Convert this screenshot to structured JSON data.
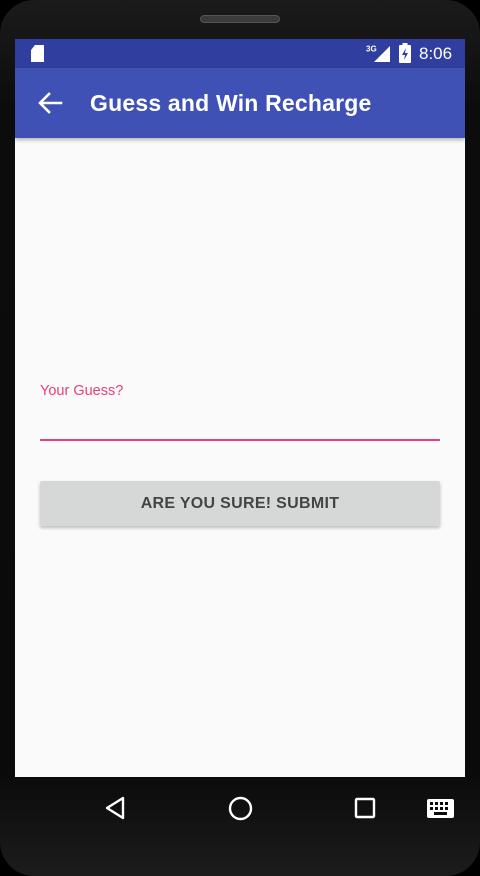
{
  "status_bar": {
    "network_type": "3G",
    "time": "8:06",
    "icons": [
      "sd-card-icon",
      "signal-icon",
      "battery-charging-icon"
    ]
  },
  "app_bar": {
    "title": "Guess and Win Recharge",
    "back_icon": "arrow-left-icon"
  },
  "form": {
    "guess_label": "Your Guess?",
    "guess_value": "",
    "submit_label": "ARE YOU SURE! SUBMIT"
  },
  "nav_bar": {
    "icons": [
      "nav-back-icon",
      "nav-home-icon",
      "nav-recents-icon",
      "keyboard-icon"
    ]
  },
  "colors": {
    "primary": "#3f51b5",
    "primary_dark": "#303f9f",
    "accent": "#e83f7a",
    "button_bg": "#d6d7d7",
    "background": "#fafafa"
  }
}
